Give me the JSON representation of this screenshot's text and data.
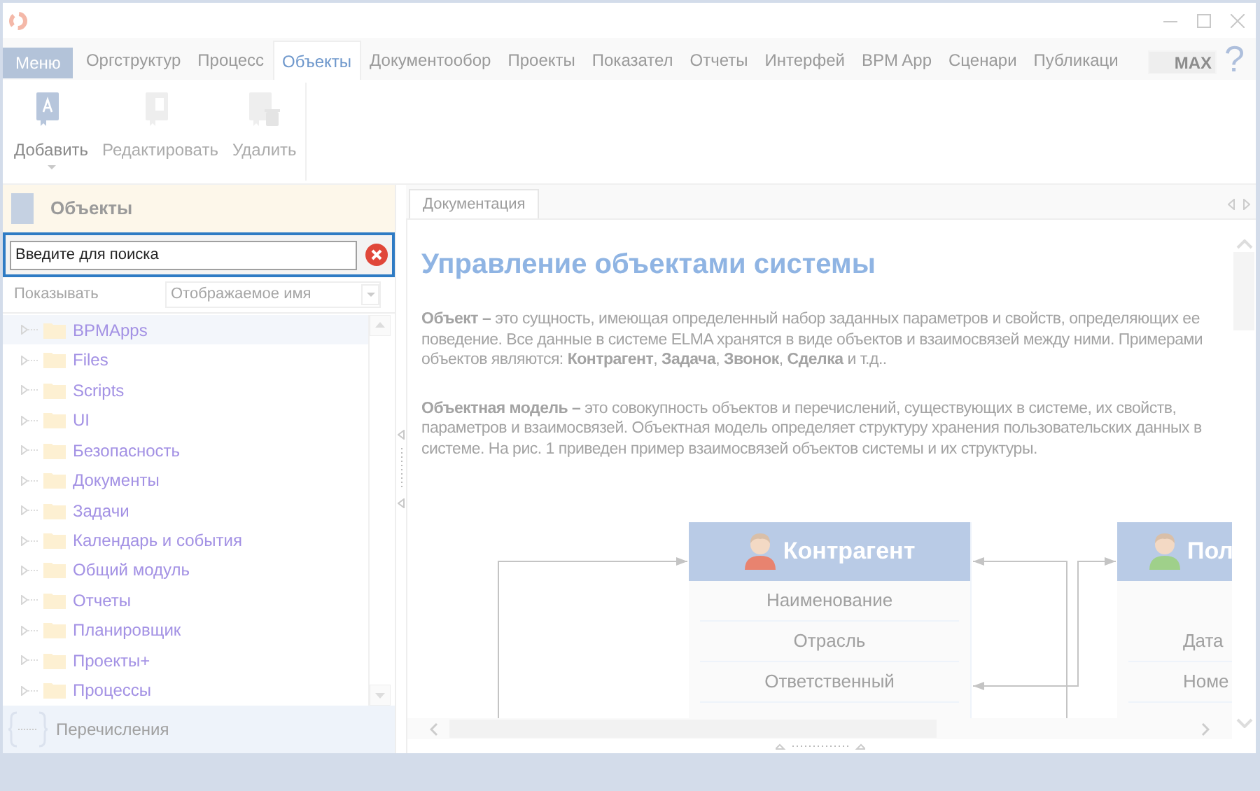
{
  "menu_button": "Меню",
  "tabs": [
    {
      "label": "Оргструктур",
      "selected": false
    },
    {
      "label": "Процесс",
      "selected": false
    },
    {
      "label": "Объекты",
      "selected": true
    },
    {
      "label": "Документообор",
      "selected": false
    },
    {
      "label": "Проекты",
      "selected": false
    },
    {
      "label": "Показател",
      "selected": false
    },
    {
      "label": "Отчеты",
      "selected": false
    },
    {
      "label": "Интерфей",
      "selected": false
    },
    {
      "label": "BPM App",
      "selected": false
    },
    {
      "label": "Сценари",
      "selected": false
    },
    {
      "label": "Публикаци",
      "selected": false
    }
  ],
  "edition_badge": "MAX",
  "help": "?",
  "ribbon": [
    {
      "kind": "add",
      "label": "Добавить",
      "disabled": false,
      "dropdown": true
    },
    {
      "kind": "edit",
      "label": "Редактировать",
      "disabled": true,
      "dropdown": false
    },
    {
      "kind": "delete",
      "label": "Удалить",
      "disabled": true,
      "dropdown": false
    }
  ],
  "left_panel": {
    "title": "Объекты",
    "search": {
      "placeholder": "Введите для поиска"
    },
    "show_label": "Показывать",
    "show_select": "Отображаемое имя",
    "tree": [
      {
        "label": "BPMApps",
        "selected": true
      },
      {
        "label": "Files",
        "selected": false
      },
      {
        "label": "Scripts",
        "selected": false
      },
      {
        "label": "UI",
        "selected": false
      },
      {
        "label": "Безопасность",
        "selected": false
      },
      {
        "label": "Документы",
        "selected": false
      },
      {
        "label": "Задачи",
        "selected": false
      },
      {
        "label": "Календарь и события",
        "selected": false
      },
      {
        "label": "Общий модуль",
        "selected": false
      },
      {
        "label": "Отчеты",
        "selected": false
      },
      {
        "label": "Планировщик",
        "selected": false
      },
      {
        "label": "Проекты+",
        "selected": false
      },
      {
        "label": "Процессы",
        "selected": false
      }
    ],
    "footer": "Перечисления"
  },
  "doc_tab": "Документация",
  "doc": {
    "heading": "Управление объектами системы",
    "paragraphs": [
      "**Объект –** это сущность, имеющая определенный набор заданных параметров и свойств, определяющих ее поведение. Все данные в системе ELMA хранятся в виде объектов и взаимосвязей между ними. Примерами объектов являются: **Контрагент**, **Задача**, **Звонок**, **Сделка** и т.д..",
      "**Объектная модель –** это совокупность объектов и перечислений, существующих в системе, их свойств, параметров и взаимосвязей. Объектная модель определяет структуру хранения пользовательских данных в системе. На рис. 1 приведен пример взаимосвязей объектов системы и их структуры."
    ],
    "diagram": [
      {
        "title": "Контрагент",
        "color": "#e8836f",
        "fields": [
          "Наименование",
          "Отрасль",
          "Ответственный"
        ]
      },
      {
        "title": "Пол",
        "color": "#9fd08a",
        "fields": [
          "Дата",
          "Номе"
        ]
      }
    ]
  }
}
